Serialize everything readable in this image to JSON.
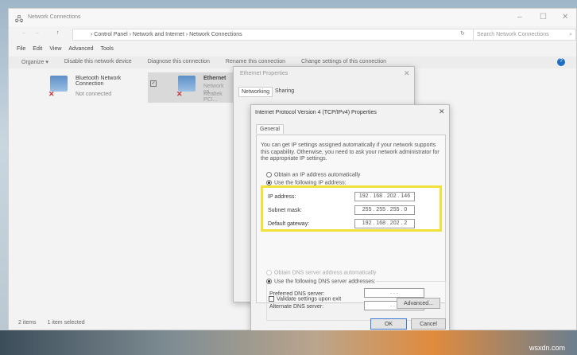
{
  "window": {
    "title": "Network Connections",
    "minimize": "–",
    "maximize": "☐",
    "close": "✕"
  },
  "address": {
    "path": "›  Control Panel  ›  Network and Internet  ›  Network Connections",
    "search_placeholder": "Search Network Connections"
  },
  "menu": [
    "File",
    "Edit",
    "View",
    "Advanced",
    "Tools"
  ],
  "toolbar": [
    "Organize ▾",
    "Disable this network device",
    "Diagnose this connection",
    "Rename this connection",
    "Change settings of this connection"
  ],
  "connections": [
    {
      "name": "Bluetooth Network Connection",
      "status": "Not connected"
    },
    {
      "name": "Ethernet",
      "status": "Network ca...",
      "device": "Realtek PCI..."
    }
  ],
  "status_bar": {
    "count": "2 items",
    "selected": "1 item selected"
  },
  "ethernet_dialog": {
    "title": "Ethernet Properties",
    "tabs": [
      "Networking",
      "Sharing"
    ]
  },
  "ipv4_dialog": {
    "title": "Internet Protocol Version 4 (TCP/IPv4) Properties",
    "tab": "General",
    "description": "You can get IP settings assigned automatically if your network supports this capability. Otherwise, you need to ask your network administrator for the appropriate IP settings.",
    "obtain_ip": "Obtain an IP address automatically",
    "use_ip": "Use the following IP address:",
    "ip_label": "IP address:",
    "ip_value": "192 . 168 . 202 . 146",
    "mask_label": "Subnet mask:",
    "mask_value": "255 . 255 . 255 .  0",
    "gw_label": "Default gateway:",
    "gw_value": "192 . 168 . 202 .  2",
    "obtain_dns": "Obtain DNS server address automatically",
    "use_dns": "Use the following DNS server addresses:",
    "pref_dns_label": "Preferred DNS server:",
    "pref_dns_value": " .    .    . ",
    "alt_dns_label": "Alternate DNS server:",
    "alt_dns_value": " .    .    . ",
    "validate": "Validate settings upon exit",
    "advanced": "Advanced...",
    "ok": "OK",
    "cancel": "Cancel"
  },
  "watermark": "wsxdn.com"
}
